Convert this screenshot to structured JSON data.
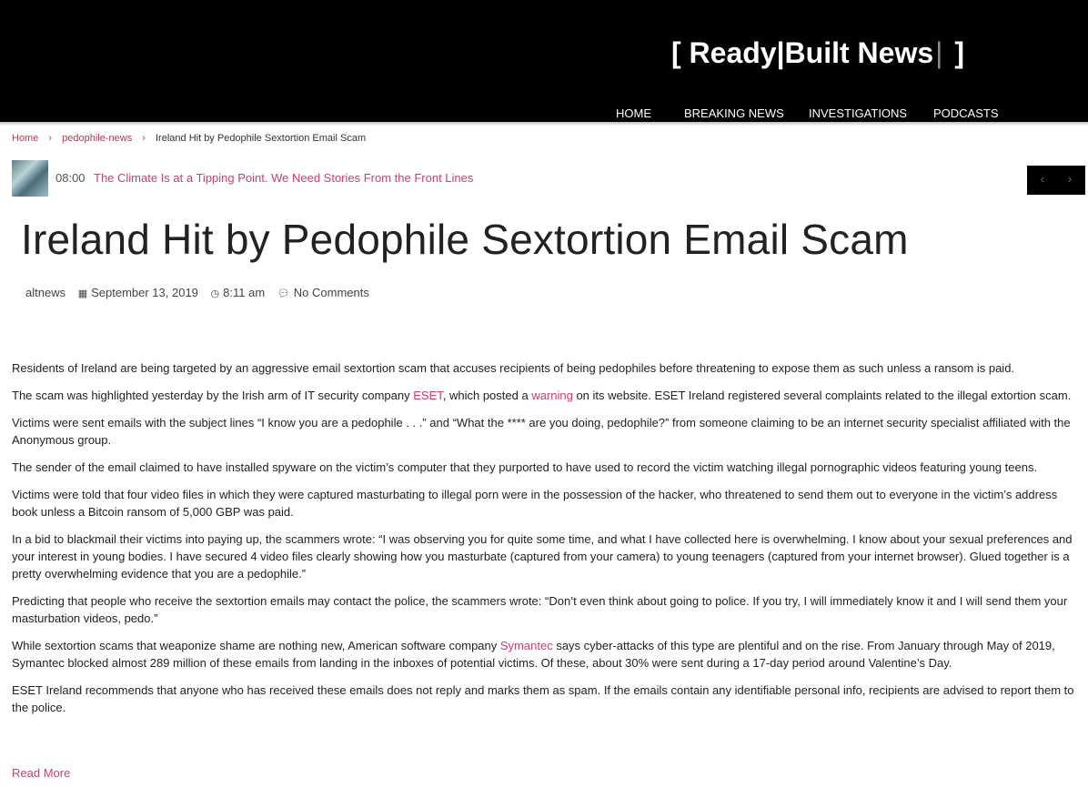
{
  "site": {
    "logo_open": "[",
    "logo_text": "Ready|Built News",
    "logo_cursor": "|",
    "logo_close": "]"
  },
  "nav": [
    "HOME",
    "BREAKING NEWS",
    "INVESTIGATIONS",
    "PODCASTS"
  ],
  "breadcrumb": {
    "home": "Home",
    "category": "pedophile-news",
    "current": "Ireland Hit by Pedophile Sextortion Email Scam",
    "sep_icon": "chevron-right-icon"
  },
  "ticker": {
    "time": "08:00",
    "headline": "The Climate Is at a Tipping Point. We Need Stories From the Front Lines",
    "prev": "‹",
    "next": "›"
  },
  "article": {
    "title": "Ireland Hit by Pedophile Sextortion Email Scam",
    "meta": {
      "author": "altnews",
      "date": "September 13, 2019",
      "time": "8:11 am",
      "comments": "No Comments"
    },
    "p1": "Residents of Ireland are being targeted by an aggressive email sextortion scam that accuses recipients of being pedophiles before threatening to expose them as such unless a ransom is paid.",
    "p2_a": "The scam was highlighted yesterday by the Irish arm of IT security company ",
    "p2_link1": "ESET",
    "p2_b": ", which posted a ",
    "p2_link2": "warning",
    "p2_c": " on its website. ESET Ireland registered several complaints related to the illegal extortion scam.",
    "p3": "Victims were sent emails with the subject lines “I know you are a pedophile . . .” and “What the **** are you doing, pedophile?” from someone claiming to be an internet security specialist affiliated with the Anonymous group.",
    "p4": "The sender of the email claimed to have installed spyware on the victim’s computer that they purported to have used to record the victim watching illegal pornographic videos featuring young teens.",
    "p5": "Victims were told that four video files in which they were captured masturbating to illegal porn were in the possession of the hacker, who threatened to send them out to everyone in the victim’s address book unless a Bitcoin ransom of 5,000 GBP was paid.",
    "p6": "In a bid to blackmail their victims into paying up, the scammers wrote: “I was observing you for quite some time, and what I have collected here is overwhelming. I know about your sexual preferences and your interest in young bodies. I have secured 4 video files clearly showing how you masturbate (captured from your camera) to young teenagers (captured from your internet browser). Glued together is a pretty overwhelming evidence that you are a pedophile.”",
    "p7": "Predicting that people who receive the sextortion emails may contact the police, the scammers wrote: “Don’t even think about going to police. If you try, I will immediately know it and I will send them your masturbation videos, pedo.”",
    "p8_a": "While sextortion scams that weaponize shame are nothing new, American software company ",
    "p8_link": "Symantec",
    "p8_b": " says cyber-attacks of this type are plentiful and on the rise. From January through May of 2019, Symantec blocked almost 289 million of these emails from landing in the inboxes of potential victims. Of these, about 30% were sent during a 17-day period around Valentine’s Day.",
    "p9": "ESET Ireland recommends that anyone who has received these emails does not reply and marks them as spam. If the emails contain any identifiable personal info, recipients are advised to report them to the police.",
    "read_more": "Read More"
  },
  "colors": {
    "header_bg": "#000000",
    "link": "#c2456b",
    "breadcrumb_link": "#b03a55"
  }
}
